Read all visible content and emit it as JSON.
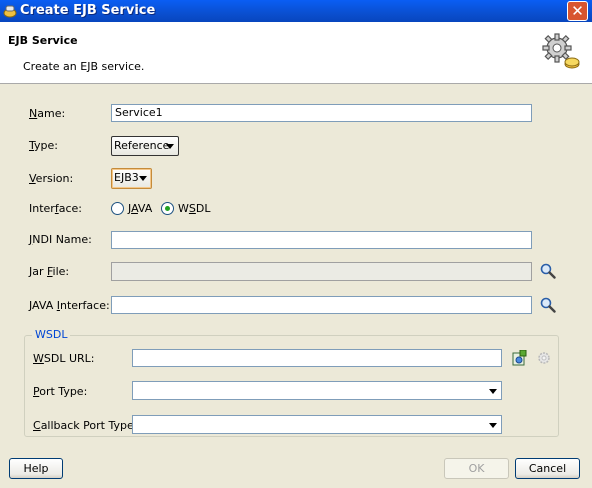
{
  "window": {
    "title": "Create EJB Service",
    "close_glyph": "✕"
  },
  "header": {
    "title": "EJB Service",
    "description": "Create an EJB service.",
    "icon": "gear-wizard-icon"
  },
  "form": {
    "name": {
      "label_mn": "N",
      "label_rest": "ame:",
      "value": "Service1"
    },
    "type": {
      "label_mn": "T",
      "label_rest": "ype:",
      "selected": "Reference"
    },
    "version": {
      "label_mn": "V",
      "label_rest": "ersion:",
      "selected": "EJB3"
    },
    "interface": {
      "label_pre": "Inter",
      "label_mn": "f",
      "label_rest": "ace:",
      "options": [
        {
          "pre": "J",
          "mn": "A",
          "rest": "VA",
          "selected": false
        },
        {
          "pre": "W",
          "mn": "S",
          "rest": "DL",
          "selected": true
        }
      ]
    },
    "jndi": {
      "label_mn": "J",
      "label_rest": "NDI Name:",
      "value": ""
    },
    "jar": {
      "label_pre": "Jar ",
      "label_mn": "F",
      "label_rest": "ile:",
      "value": ""
    },
    "java_interface": {
      "label_pre": "JAVA ",
      "label_mn": "I",
      "label_rest": "nterface:",
      "value": ""
    }
  },
  "wsdl": {
    "group_title": "WSDL",
    "url": {
      "label_mn": "W",
      "label_rest": "SDL URL:",
      "value": ""
    },
    "port_type": {
      "label_mn": "P",
      "label_rest": "ort Type:",
      "selected": ""
    },
    "callback_port_type": {
      "label_mn": "C",
      "label_rest": "allback Port Type:",
      "selected": ""
    }
  },
  "footer": {
    "help": "Help",
    "ok": "OK",
    "cancel": "Cancel"
  },
  "colors": {
    "titlebar": "#0a5ef4",
    "dialog_bg": "#ece9d8",
    "group_title": "#0046d5"
  }
}
